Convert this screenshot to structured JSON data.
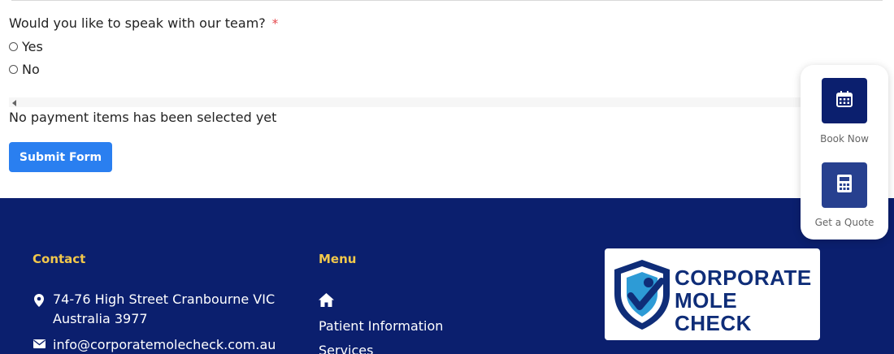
{
  "form": {
    "question": "Would you like to speak with our team?",
    "required_mark": "*",
    "options": [
      "Yes",
      "No"
    ],
    "payment_message": "No payment items has been selected yet",
    "submit_label": "Submit Form"
  },
  "footer": {
    "contact": {
      "heading": "Contact",
      "address_line1": "74-76 High Street Cranbourne VIC",
      "address_line2": "Australia 3977",
      "email": "info@corporatemolecheck.com.au"
    },
    "menu": {
      "heading": "Menu",
      "items": [
        "Patient Information",
        "Services"
      ]
    },
    "logo": {
      "line1": "CORPORATE",
      "line2": "MOLE CHECK"
    }
  },
  "floating_widget": {
    "book_label": "Book Now",
    "quote_label": "Get a Quote"
  },
  "colors": {
    "footer_bg": "#0b1f6e",
    "heading_gold": "#f2c84b",
    "submit_blue": "#2a7ff0",
    "required_red": "#e5484d"
  },
  "icons": [
    "radio-icon",
    "scroll-left-icon",
    "location-pin-icon",
    "email-icon",
    "home-icon",
    "calendar-icon",
    "calculator-icon",
    "shield-logo-icon"
  ]
}
